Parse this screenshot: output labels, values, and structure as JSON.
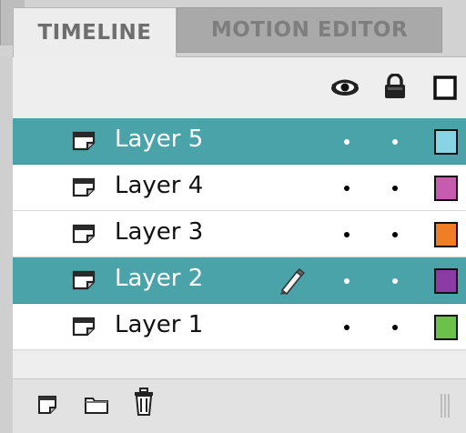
{
  "tabs": [
    {
      "label": "TIMELINE",
      "active": true
    },
    {
      "label": "MOTION EDITOR",
      "active": false
    }
  ],
  "header": {
    "icons": [
      "eye-icon",
      "lock-icon",
      "outline-icon"
    ]
  },
  "layers": [
    {
      "name": "Layer 5",
      "selected": true,
      "color": "#87d4e4",
      "pencil": false
    },
    {
      "name": "Layer 4",
      "selected": false,
      "color": "#c65bb0",
      "pencil": false
    },
    {
      "name": "Layer 3",
      "selected": false,
      "color": "#ef7e27",
      "pencil": false
    },
    {
      "name": "Layer 2",
      "selected": true,
      "color": "#8b3aa6",
      "pencil": true
    },
    {
      "name": "Layer 1",
      "selected": false,
      "color": "#6cc14a",
      "pencil": false
    }
  ],
  "toolbar": {
    "buttons": [
      "new-layer-icon",
      "new-folder-icon",
      "delete-icon"
    ]
  },
  "colors": {
    "selection": "#4aa3a8",
    "row": "#ffffff",
    "panel": "#e6e6e6"
  }
}
